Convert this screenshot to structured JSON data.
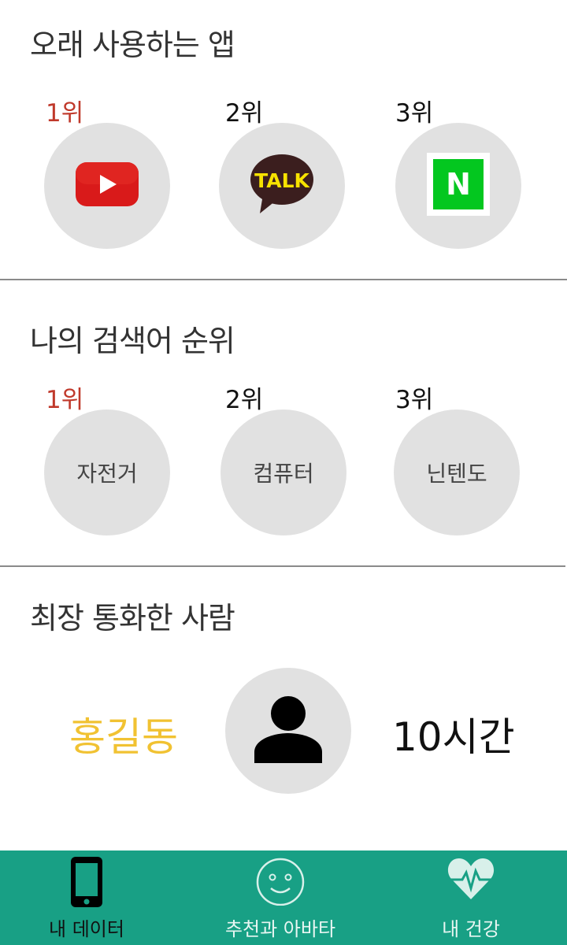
{
  "sections": {
    "apps": {
      "title": "오래 사용하는 앱",
      "items": [
        {
          "rank": "1위",
          "app": "YouTube",
          "icon": "youtube-icon"
        },
        {
          "rank": "2위",
          "app": "KakaoTalk",
          "icon": "kakaotalk-icon",
          "icon_text": "TALK"
        },
        {
          "rank": "3위",
          "app": "Naver",
          "icon": "naver-icon",
          "icon_text": "N"
        }
      ]
    },
    "search": {
      "title": "나의 검색어 순위",
      "items": [
        {
          "rank": "1위",
          "keyword": "자전거"
        },
        {
          "rank": "2위",
          "keyword": "컴퓨터"
        },
        {
          "rank": "3위",
          "keyword": "닌텐도"
        }
      ]
    },
    "calls": {
      "title": "최장 통화한 사람",
      "name": "홍길동",
      "duration": "10시간",
      "avatar_icon": "person-icon"
    }
  },
  "bottom_nav": {
    "items": [
      {
        "label": "내 데이터",
        "icon": "phone-icon",
        "active": true
      },
      {
        "label": "추천과 아바타",
        "icon": "smiley-icon",
        "active": false
      },
      {
        "label": "내 건강",
        "icon": "heart-pulse-icon",
        "active": false
      }
    ]
  },
  "colors": {
    "first_rank": "#c0392b",
    "name_highlight": "#f1c232",
    "nav_background": "#18a085",
    "circle_background": "#e1e1e1"
  }
}
